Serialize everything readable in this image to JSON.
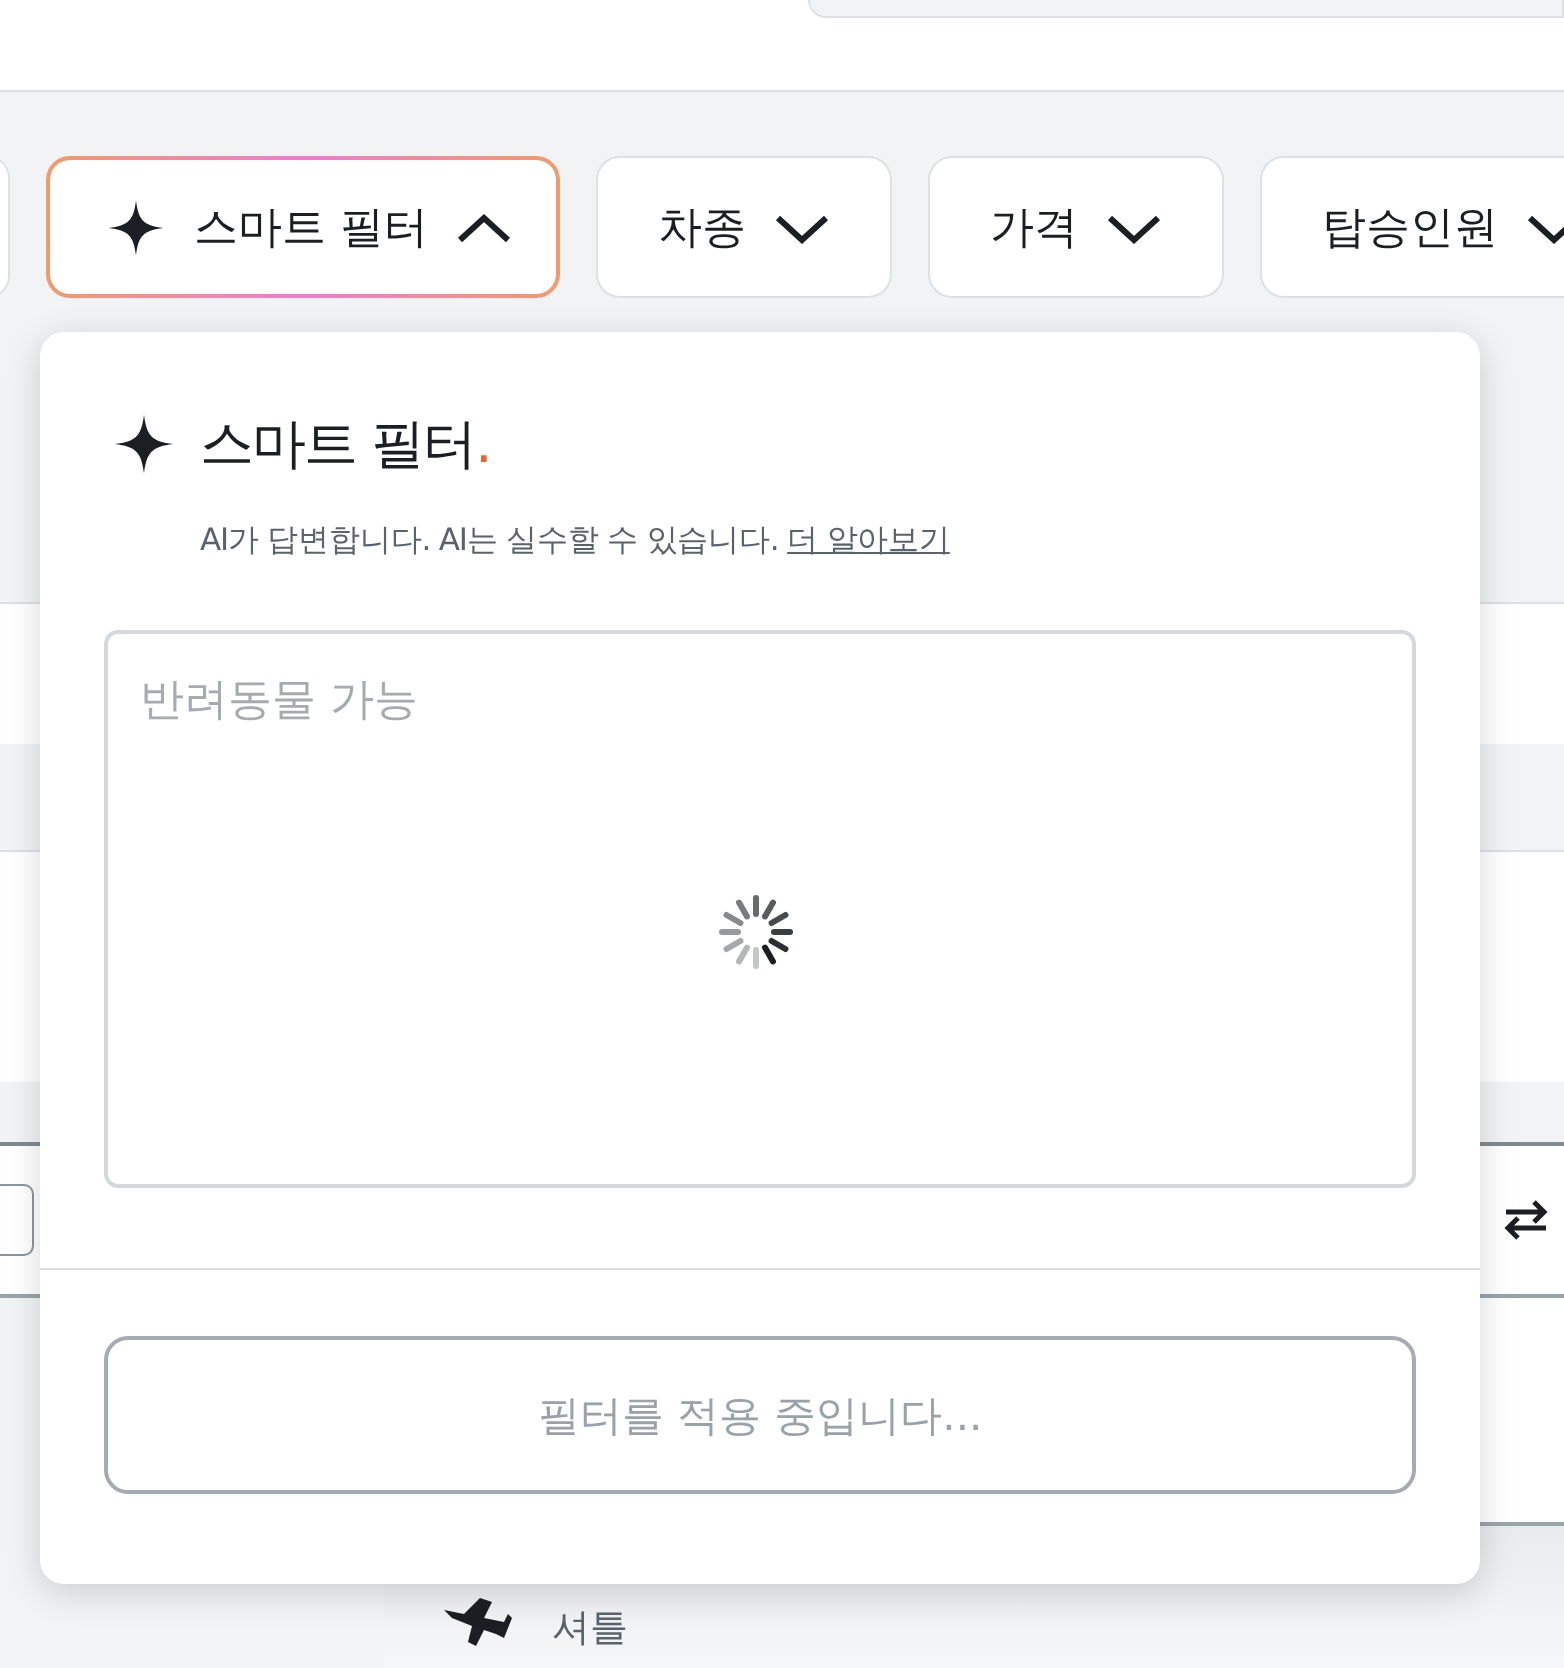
{
  "filters": [
    {
      "kind": "stub"
    },
    {
      "kind": "smart",
      "label": "스마트 필터",
      "expanded": true
    },
    {
      "kind": "dropdown",
      "label": "차종",
      "expanded": false
    },
    {
      "kind": "dropdown",
      "label": "가격",
      "expanded": false
    },
    {
      "kind": "dropdown",
      "label": "탑승인원",
      "expanded": false
    }
  ],
  "smart_filter": {
    "title": "스마트 필터",
    "title_mark": ".",
    "notice": "AI가 답변합니다. AI는 실수할 수 있습니다.",
    "learn_more": "더 알아보기",
    "input": {
      "placeholder": "반려동물 가능",
      "loading": true
    },
    "apply_button": {
      "label": "필터를 적용 중입니다...",
      "disabled": true
    }
  },
  "shuttle": {
    "label": "셔틀"
  }
}
